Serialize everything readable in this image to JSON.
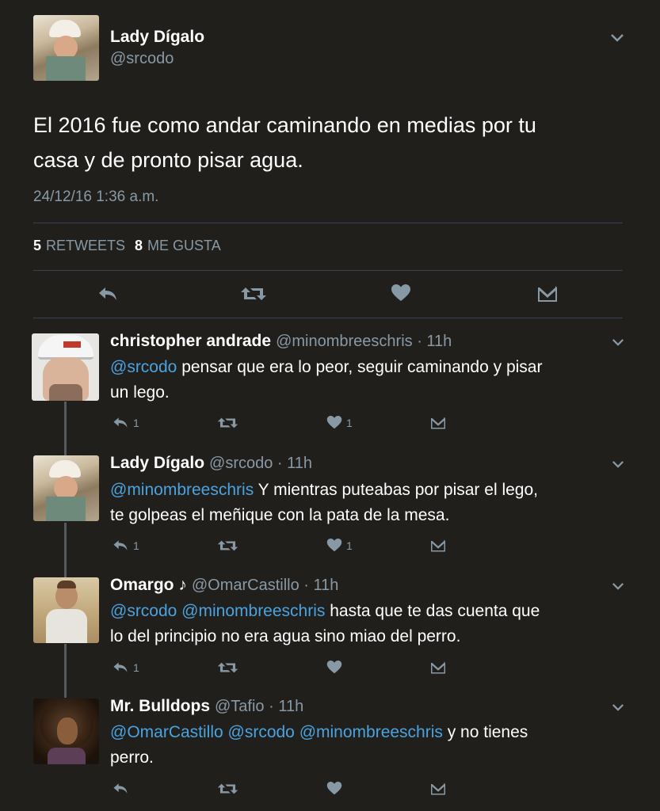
{
  "main_tweet": {
    "author_name": "Lady Dígalo",
    "author_handle": "@srcodo",
    "text_line1": "El 2016 fue como andar caminando en medias por tu",
    "text_line2": "casa y de pronto pisar agua.",
    "timestamp": "24/12/16 1:36 a.m.",
    "retweets_count": "5",
    "retweets_label": "RETWEETS",
    "likes_count": "8",
    "likes_label": "ME GUSTA"
  },
  "replies": [
    {
      "name": "christopher andrade",
      "handle_time": "@minombreeschris · 11h",
      "mentions": "@srcodo",
      "line1_rest": " pensar que era lo peor, seguir caminando y pisar",
      "line2": "un lego.",
      "reply_count": "1",
      "like_count": "1"
    },
    {
      "name": "Lady Dígalo",
      "handle_time": "@srcodo · 11h",
      "mentions": "@minombreeschris",
      "line1_rest": " Y mientras puteabas por pisar el lego,",
      "line2": "te golpeas el meñique con la pata de la mesa.",
      "reply_count": "1",
      "like_count": "1"
    },
    {
      "name": "Omargo ♪",
      "handle_time": "@OmarCastillo · 11h",
      "mentions": "@srcodo @minombreeschris",
      "line1_rest": " hasta que te das cuenta que",
      "line2": "lo del principio no era agua sino miao del perro.",
      "reply_count": "1",
      "like_count": ""
    },
    {
      "name": "Mr. Bulldops",
      "handle_time": "@Tafio · 11h",
      "mentions": "@OmarCastillo @srcodo @minombreeschris",
      "line1_rest": " y no tienes",
      "line2": "perro.",
      "reply_count": "",
      "like_count": ""
    }
  ],
  "icons": {
    "reply": "reply-icon",
    "retweet": "retweet-icon",
    "like": "heart-icon",
    "dm": "envelope-icon",
    "menu": "chevron-down-icon"
  },
  "colors": {
    "background": "#211f1c",
    "mention": "#4aa3df",
    "muted": "#8899a6",
    "icon": "#8899a6"
  }
}
